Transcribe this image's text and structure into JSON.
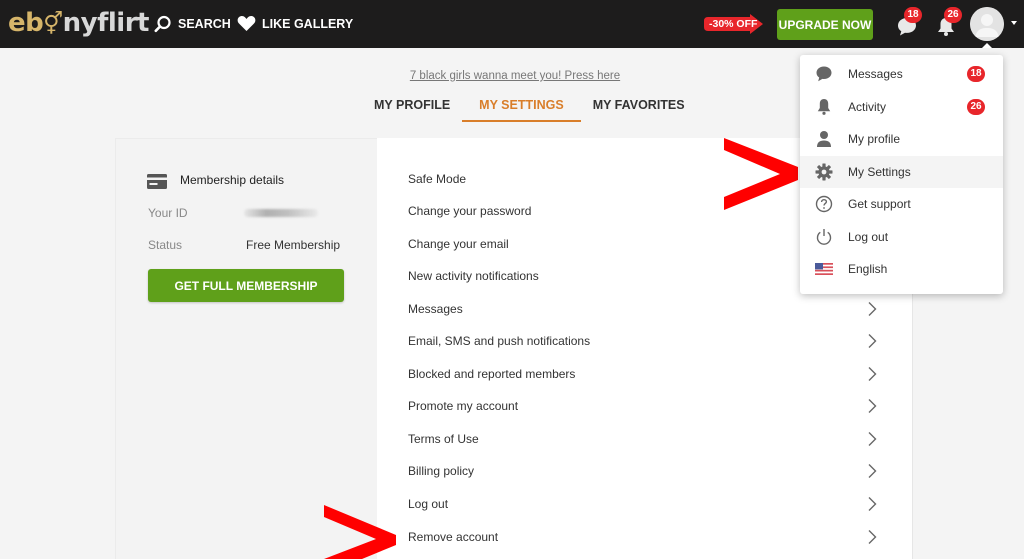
{
  "header": {
    "logo": {
      "part1": "eb",
      "part2": "nyflirt",
      "gender_glyph": "⚥"
    },
    "nav": [
      {
        "label": "SEARCH",
        "icon": "search-icon"
      },
      {
        "label": "LIKE GALLERY",
        "icon": "heart-icon"
      }
    ],
    "discount_label": "-30% OFF",
    "upgrade_label": "UPGRADE NOW",
    "messages_count": "18",
    "activity_count": "26"
  },
  "promo_link": "7 black girls wanna meet you! Press here",
  "tabs": [
    {
      "label": "MY PROFILE",
      "active": false
    },
    {
      "label": "MY SETTINGS",
      "active": true
    },
    {
      "label": "MY FAVORITES",
      "active": false
    }
  ],
  "membership": {
    "title": "Membership details",
    "id_label": "Your ID",
    "id_value": "",
    "status_label": "Status",
    "status_value": "Free Membership",
    "button_label": "GET FULL MEMBERSHIP"
  },
  "settings": {
    "items": [
      {
        "label": "Safe Mode"
      },
      {
        "label": "Change your password"
      },
      {
        "label": "Change your email"
      },
      {
        "label": "New activity notifications"
      },
      {
        "label": "Messages"
      },
      {
        "label": "Email, SMS and push notifications"
      },
      {
        "label": "Blocked and reported members"
      },
      {
        "label": "Promote my account"
      },
      {
        "label": "Terms of Use"
      },
      {
        "label": "Billing policy"
      },
      {
        "label": "Log out"
      },
      {
        "label": "Remove account"
      }
    ]
  },
  "dropdown": {
    "items": [
      {
        "label": "Messages",
        "icon": "chat-bubble-icon",
        "badge": "18"
      },
      {
        "label": "Activity",
        "icon": "bell-icon",
        "badge": "26"
      },
      {
        "label": "My profile",
        "icon": "person-icon"
      },
      {
        "label": "My Settings",
        "icon": "gear-icon",
        "active": true
      },
      {
        "label": "Get support",
        "icon": "help-circle-icon"
      },
      {
        "label": "Log out",
        "icon": "power-icon"
      },
      {
        "label": "English",
        "icon": "us-flag-icon"
      }
    ]
  },
  "colors": {
    "accent_orange": "#d97e2a",
    "green": "#5fa01a",
    "badge_red": "#e8262b",
    "annotation_red": "#ff0000",
    "logo_gold": "#d6b56a"
  }
}
